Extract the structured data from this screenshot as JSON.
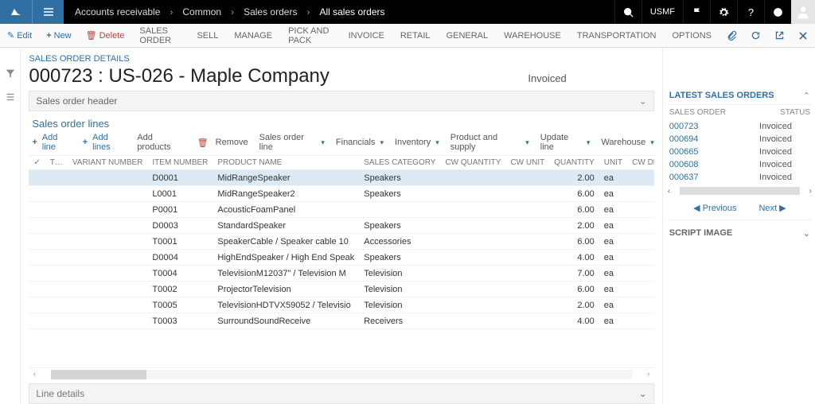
{
  "breadcrumbs": [
    "Accounts receivable",
    "Common",
    "Sales orders",
    "All sales orders"
  ],
  "company": "USMF",
  "ribbon": {
    "edit": "Edit",
    "new": "New",
    "delete": "Delete",
    "tabs": [
      "SALES ORDER",
      "SELL",
      "MANAGE",
      "PICK AND PACK",
      "INVOICE",
      "RETAIL",
      "GENERAL",
      "WAREHOUSE",
      "TRANSPORTATION",
      "OPTIONS"
    ]
  },
  "section_title": "SALES ORDER DETAILS",
  "page_title": "000723 : US-026 - Maple Company",
  "page_status": "Invoiced",
  "header_expander": "Sales order header",
  "lines_title": "Sales order lines",
  "linetools": {
    "addline": "Add line",
    "addlines": "Add lines",
    "addproducts": "Add products",
    "remove": "Remove",
    "salesorderline": "Sales order line",
    "financials": "Financials",
    "inventory": "Inventory",
    "productsupply": "Product and supply",
    "updateline": "Update line",
    "warehouse": "Warehouse"
  },
  "grid": {
    "headers": {
      "check": "✓",
      "t": "T…",
      "variant": "VARIANT NUMBER",
      "item": "ITEM NUMBER",
      "product": "PRODUCT NAME",
      "salescat": "SALES CATEGORY",
      "cwqty": "CW QUANTITY",
      "cwunit": "CW UNIT",
      "qty": "QUANTITY",
      "unit": "UNIT",
      "cwdeliver": "CW DELIVER I"
    },
    "rows": [
      {
        "item": "D0001",
        "product": "MidRangeSpeaker",
        "salescat": "Speakers",
        "qty": "2.00",
        "unit": "ea",
        "sel": true
      },
      {
        "item": "L0001",
        "product": "MidRangeSpeaker2",
        "salescat": "Speakers",
        "qty": "6.00",
        "unit": "ea"
      },
      {
        "item": "P0001",
        "product": "AcousticFoamPanel",
        "salescat": "",
        "qty": "6.00",
        "unit": "ea"
      },
      {
        "item": "D0003",
        "product": "StandardSpeaker",
        "salescat": "Speakers",
        "qty": "2.00",
        "unit": "ea"
      },
      {
        "item": "T0001",
        "product": "SpeakerCable / Speaker cable 10",
        "salescat": "Accessories",
        "qty": "6.00",
        "unit": "ea"
      },
      {
        "item": "D0004",
        "product": "HighEndSpeaker / High End Speak",
        "salescat": "Speakers",
        "qty": "4.00",
        "unit": "ea"
      },
      {
        "item": "T0004",
        "product": "TelevisionM12037\" / Television M",
        "salescat": "Television",
        "qty": "7.00",
        "unit": "ea"
      },
      {
        "item": "T0002",
        "product": "ProjectorTelevision",
        "salescat": "Television",
        "qty": "6.00",
        "unit": "ea"
      },
      {
        "item": "T0005",
        "product": "TelevisionHDTVX59052 / Televisio",
        "salescat": "Television",
        "qty": "2.00",
        "unit": "ea"
      },
      {
        "item": "T0003",
        "product": "SurroundSoundReceive",
        "salescat": "Receivers",
        "qty": "4.00",
        "unit": "ea"
      }
    ]
  },
  "line_details": "Line details",
  "rightpane": {
    "title": "LATEST SALES ORDERS",
    "cols": {
      "so": "SALES ORDER",
      "status": "STATUS"
    },
    "rows": [
      {
        "so": "000723",
        "status": "Invoiced"
      },
      {
        "so": "000694",
        "status": "Invoiced"
      },
      {
        "so": "000665",
        "status": "Invoiced"
      },
      {
        "so": "000608",
        "status": "Invoiced"
      },
      {
        "so": "000637",
        "status": "Invoiced"
      }
    ],
    "prev": "Previous",
    "next": "Next",
    "scriptimage": "SCRIPT IMAGE"
  }
}
